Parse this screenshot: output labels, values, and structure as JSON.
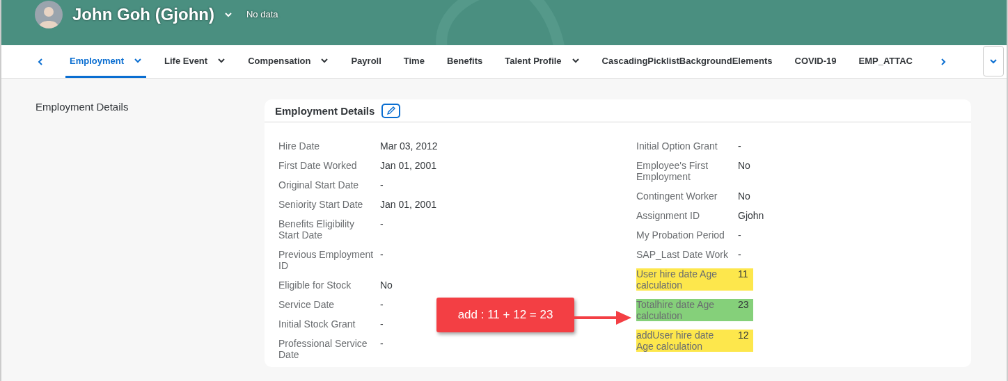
{
  "header": {
    "name": "John Goh (Gjohn)",
    "status": "No data"
  },
  "tabs": [
    {
      "label": "Employment",
      "selected": true,
      "dropdown": true
    },
    {
      "label": "Life Event",
      "selected": false,
      "dropdown": true
    },
    {
      "label": "Compensation",
      "selected": false,
      "dropdown": true
    },
    {
      "label": "Payroll",
      "selected": false,
      "dropdown": false
    },
    {
      "label": "Time",
      "selected": false,
      "dropdown": false
    },
    {
      "label": "Benefits",
      "selected": false,
      "dropdown": false
    },
    {
      "label": "Talent Profile",
      "selected": false,
      "dropdown": true
    },
    {
      "label": "CascadingPicklistBackgroundElements",
      "selected": false,
      "dropdown": false
    },
    {
      "label": "COVID-19",
      "selected": false,
      "dropdown": false
    },
    {
      "label": "EMP_ATTAC",
      "selected": false,
      "dropdown": false
    }
  ],
  "side_label": "Employment Details",
  "card": {
    "title": "Employment Details",
    "left_fields": [
      {
        "label": "Hire Date",
        "value": "Mar 03, 2012"
      },
      {
        "label": "First Date Worked",
        "value": "Jan 01, 2001"
      },
      {
        "label": "Original Start Date",
        "value": "-"
      },
      {
        "label": "Seniority Start Date",
        "value": "Jan 01, 2001"
      },
      {
        "label": "Benefits Eligibility Start Date",
        "value": "-"
      },
      {
        "label": "Previous Employment ID",
        "value": "-"
      },
      {
        "label": "Eligible for Stock",
        "value": "No"
      },
      {
        "label": "Service Date",
        "value": "-"
      },
      {
        "label": "Initial Stock Grant",
        "value": "-"
      },
      {
        "label": "Professional Service Date",
        "value": "-"
      }
    ],
    "right_fields": [
      {
        "label": "Initial Option Grant",
        "value": "-"
      },
      {
        "label": "Employee's First Employment",
        "value": "No"
      },
      {
        "label": "Contingent Worker",
        "value": "No"
      },
      {
        "label": "Assignment ID",
        "value": "Gjohn"
      },
      {
        "label": "My Probation Period",
        "value": "-"
      },
      {
        "label": "SAP_Last Date Work",
        "value": "-"
      },
      {
        "label": "User hire date Age calculation",
        "value": "11",
        "color": "#fde74c"
      },
      {
        "label": "Totalhire date Age calculation",
        "value": "23",
        "color": "#85d07a"
      },
      {
        "label": "addUser hire date Age calculation",
        "value": "12",
        "color": "#fde74c"
      }
    ]
  },
  "callout": {
    "text": "add : 11 + 12 = 23"
  }
}
